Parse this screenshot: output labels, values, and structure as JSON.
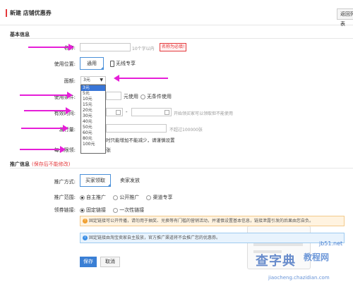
{
  "header": {
    "title": "新建 店铺优惠券",
    "back_label": "返回列表"
  },
  "basic": {
    "section_title": "基本信息",
    "name_label": "名称:",
    "name_hint": "10个字以内",
    "name_error": "名称为必填!",
    "position_label": "使用位置:",
    "position_options": [
      "通用",
      "无线专享"
    ],
    "face_label": "面额:",
    "face_selected": "3元",
    "face_options": [
      "3元",
      "5元",
      "10元",
      "15元",
      "20元",
      "30元",
      "40元",
      "50元",
      "60元",
      "80元",
      "100元"
    ],
    "condition_label": "使用条件:",
    "condition_unit": "元使用",
    "condition_none": "无条件使用",
    "validity_label": "有效时间:",
    "validity_hint": "开始领买家可以领取但不能使用",
    "issue_label": "发行量:",
    "issue_hint": "不超过100000张",
    "issue_note": "时只能增加不能减少，请谨慎设置",
    "limit_label": "每人限领:",
    "limit_suffix": "张"
  },
  "promo": {
    "section_title": "推广信息",
    "section_note": "(保存后不能修改)",
    "method_label": "推广方式:",
    "method_options": [
      "买家领取",
      "卖家发放"
    ],
    "scope_label": "推广范围:",
    "scope_options": [
      "自主推广",
      "公开推广",
      "渠道专享"
    ],
    "link_label": "领券链接:",
    "link_options": [
      "固定链接",
      "一次性链接"
    ],
    "warn_icon": "!",
    "warn_text": "固定链接可公开传播，请勿用于抽奖、兑换等有门槛的营销活动，并谨慎设置基本信息，链接泄露引发的后果由您自负。",
    "info_icon": "i",
    "info_text": "固定链接由淘宝卖家自主投放，官方推广渠道将不会推广您的优惠券。"
  },
  "actions": {
    "save_label": "保存",
    "cancel_label": "取消"
  },
  "watermark": {
    "brand": "查字典",
    "site": "教程网",
    "url": "jiaocheng.chazidian.com",
    "domain": "jb51.net"
  },
  "colors": {
    "accent": "#e4393c",
    "primary": "#3a7fd5",
    "arrow": "#e61ed8"
  }
}
